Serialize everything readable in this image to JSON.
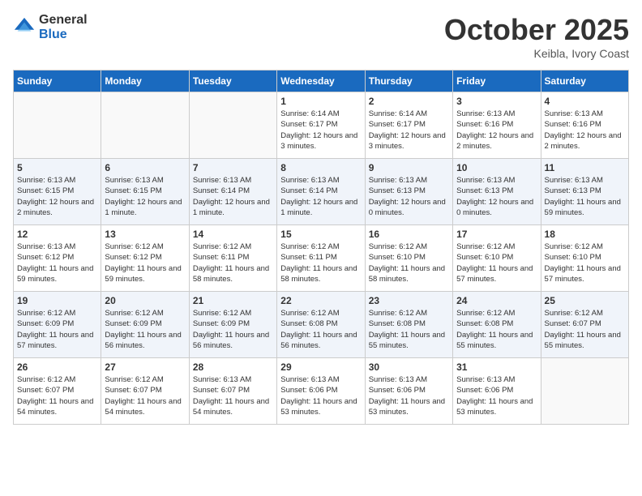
{
  "header": {
    "logo_general": "General",
    "logo_blue": "Blue",
    "month_title": "October 2025",
    "subtitle": "Keibla, Ivory Coast"
  },
  "weekdays": [
    "Sunday",
    "Monday",
    "Tuesday",
    "Wednesday",
    "Thursday",
    "Friday",
    "Saturday"
  ],
  "weeks": [
    [
      {
        "num": "",
        "empty": true
      },
      {
        "num": "",
        "empty": true
      },
      {
        "num": "",
        "empty": true
      },
      {
        "num": "1",
        "sunrise": "Sunrise: 6:14 AM",
        "sunset": "Sunset: 6:17 PM",
        "daylight": "Daylight: 12 hours and 3 minutes."
      },
      {
        "num": "2",
        "sunrise": "Sunrise: 6:14 AM",
        "sunset": "Sunset: 6:17 PM",
        "daylight": "Daylight: 12 hours and 3 minutes."
      },
      {
        "num": "3",
        "sunrise": "Sunrise: 6:13 AM",
        "sunset": "Sunset: 6:16 PM",
        "daylight": "Daylight: 12 hours and 2 minutes."
      },
      {
        "num": "4",
        "sunrise": "Sunrise: 6:13 AM",
        "sunset": "Sunset: 6:16 PM",
        "daylight": "Daylight: 12 hours and 2 minutes."
      }
    ],
    [
      {
        "num": "5",
        "sunrise": "Sunrise: 6:13 AM",
        "sunset": "Sunset: 6:15 PM",
        "daylight": "Daylight: 12 hours and 2 minutes."
      },
      {
        "num": "6",
        "sunrise": "Sunrise: 6:13 AM",
        "sunset": "Sunset: 6:15 PM",
        "daylight": "Daylight: 12 hours and 1 minute."
      },
      {
        "num": "7",
        "sunrise": "Sunrise: 6:13 AM",
        "sunset": "Sunset: 6:14 PM",
        "daylight": "Daylight: 12 hours and 1 minute."
      },
      {
        "num": "8",
        "sunrise": "Sunrise: 6:13 AM",
        "sunset": "Sunset: 6:14 PM",
        "daylight": "Daylight: 12 hours and 1 minute."
      },
      {
        "num": "9",
        "sunrise": "Sunrise: 6:13 AM",
        "sunset": "Sunset: 6:13 PM",
        "daylight": "Daylight: 12 hours and 0 minutes."
      },
      {
        "num": "10",
        "sunrise": "Sunrise: 6:13 AM",
        "sunset": "Sunset: 6:13 PM",
        "daylight": "Daylight: 12 hours and 0 minutes."
      },
      {
        "num": "11",
        "sunrise": "Sunrise: 6:13 AM",
        "sunset": "Sunset: 6:13 PM",
        "daylight": "Daylight: 11 hours and 59 minutes."
      }
    ],
    [
      {
        "num": "12",
        "sunrise": "Sunrise: 6:13 AM",
        "sunset": "Sunset: 6:12 PM",
        "daylight": "Daylight: 11 hours and 59 minutes."
      },
      {
        "num": "13",
        "sunrise": "Sunrise: 6:12 AM",
        "sunset": "Sunset: 6:12 PM",
        "daylight": "Daylight: 11 hours and 59 minutes."
      },
      {
        "num": "14",
        "sunrise": "Sunrise: 6:12 AM",
        "sunset": "Sunset: 6:11 PM",
        "daylight": "Daylight: 11 hours and 58 minutes."
      },
      {
        "num": "15",
        "sunrise": "Sunrise: 6:12 AM",
        "sunset": "Sunset: 6:11 PM",
        "daylight": "Daylight: 11 hours and 58 minutes."
      },
      {
        "num": "16",
        "sunrise": "Sunrise: 6:12 AM",
        "sunset": "Sunset: 6:10 PM",
        "daylight": "Daylight: 11 hours and 58 minutes."
      },
      {
        "num": "17",
        "sunrise": "Sunrise: 6:12 AM",
        "sunset": "Sunset: 6:10 PM",
        "daylight": "Daylight: 11 hours and 57 minutes."
      },
      {
        "num": "18",
        "sunrise": "Sunrise: 6:12 AM",
        "sunset": "Sunset: 6:10 PM",
        "daylight": "Daylight: 11 hours and 57 minutes."
      }
    ],
    [
      {
        "num": "19",
        "sunrise": "Sunrise: 6:12 AM",
        "sunset": "Sunset: 6:09 PM",
        "daylight": "Daylight: 11 hours and 57 minutes."
      },
      {
        "num": "20",
        "sunrise": "Sunrise: 6:12 AM",
        "sunset": "Sunset: 6:09 PM",
        "daylight": "Daylight: 11 hours and 56 minutes."
      },
      {
        "num": "21",
        "sunrise": "Sunrise: 6:12 AM",
        "sunset": "Sunset: 6:09 PM",
        "daylight": "Daylight: 11 hours and 56 minutes."
      },
      {
        "num": "22",
        "sunrise": "Sunrise: 6:12 AM",
        "sunset": "Sunset: 6:08 PM",
        "daylight": "Daylight: 11 hours and 56 minutes."
      },
      {
        "num": "23",
        "sunrise": "Sunrise: 6:12 AM",
        "sunset": "Sunset: 6:08 PM",
        "daylight": "Daylight: 11 hours and 55 minutes."
      },
      {
        "num": "24",
        "sunrise": "Sunrise: 6:12 AM",
        "sunset": "Sunset: 6:08 PM",
        "daylight": "Daylight: 11 hours and 55 minutes."
      },
      {
        "num": "25",
        "sunrise": "Sunrise: 6:12 AM",
        "sunset": "Sunset: 6:07 PM",
        "daylight": "Daylight: 11 hours and 55 minutes."
      }
    ],
    [
      {
        "num": "26",
        "sunrise": "Sunrise: 6:12 AM",
        "sunset": "Sunset: 6:07 PM",
        "daylight": "Daylight: 11 hours and 54 minutes."
      },
      {
        "num": "27",
        "sunrise": "Sunrise: 6:12 AM",
        "sunset": "Sunset: 6:07 PM",
        "daylight": "Daylight: 11 hours and 54 minutes."
      },
      {
        "num": "28",
        "sunrise": "Sunrise: 6:13 AM",
        "sunset": "Sunset: 6:07 PM",
        "daylight": "Daylight: 11 hours and 54 minutes."
      },
      {
        "num": "29",
        "sunrise": "Sunrise: 6:13 AM",
        "sunset": "Sunset: 6:06 PM",
        "daylight": "Daylight: 11 hours and 53 minutes."
      },
      {
        "num": "30",
        "sunrise": "Sunrise: 6:13 AM",
        "sunset": "Sunset: 6:06 PM",
        "daylight": "Daylight: 11 hours and 53 minutes."
      },
      {
        "num": "31",
        "sunrise": "Sunrise: 6:13 AM",
        "sunset": "Sunset: 6:06 PM",
        "daylight": "Daylight: 11 hours and 53 minutes."
      },
      {
        "num": "",
        "empty": true
      }
    ]
  ]
}
